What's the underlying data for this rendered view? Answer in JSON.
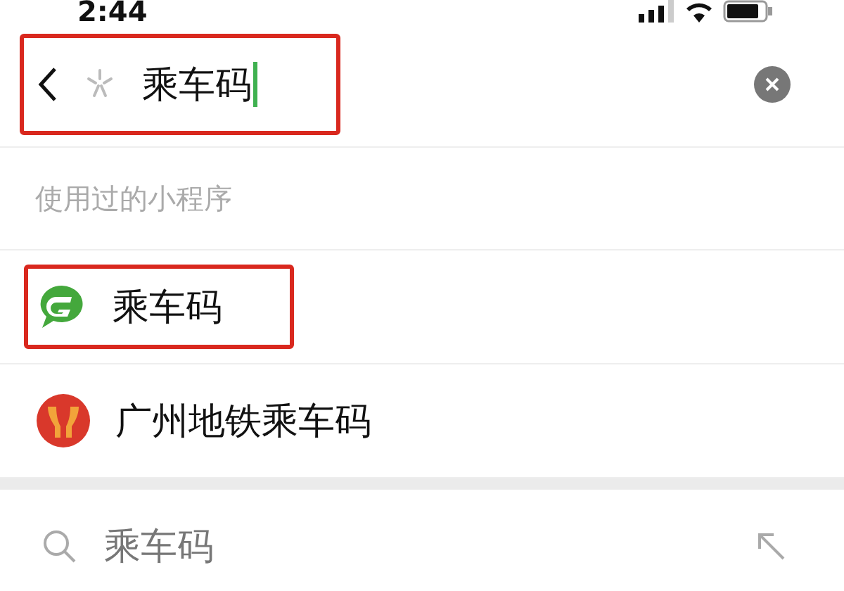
{
  "status_bar": {
    "time": "2:44"
  },
  "search": {
    "value": "乘车码",
    "highlighted": true
  },
  "section": {
    "title": "使用过的小程序"
  },
  "results": [
    {
      "kind": "green-g",
      "name": "乘车码",
      "highlighted": true
    },
    {
      "kind": "metro",
      "name": "广州地铁乘车码",
      "highlighted": false
    }
  ],
  "suggestion": {
    "text": "乘车码"
  }
}
